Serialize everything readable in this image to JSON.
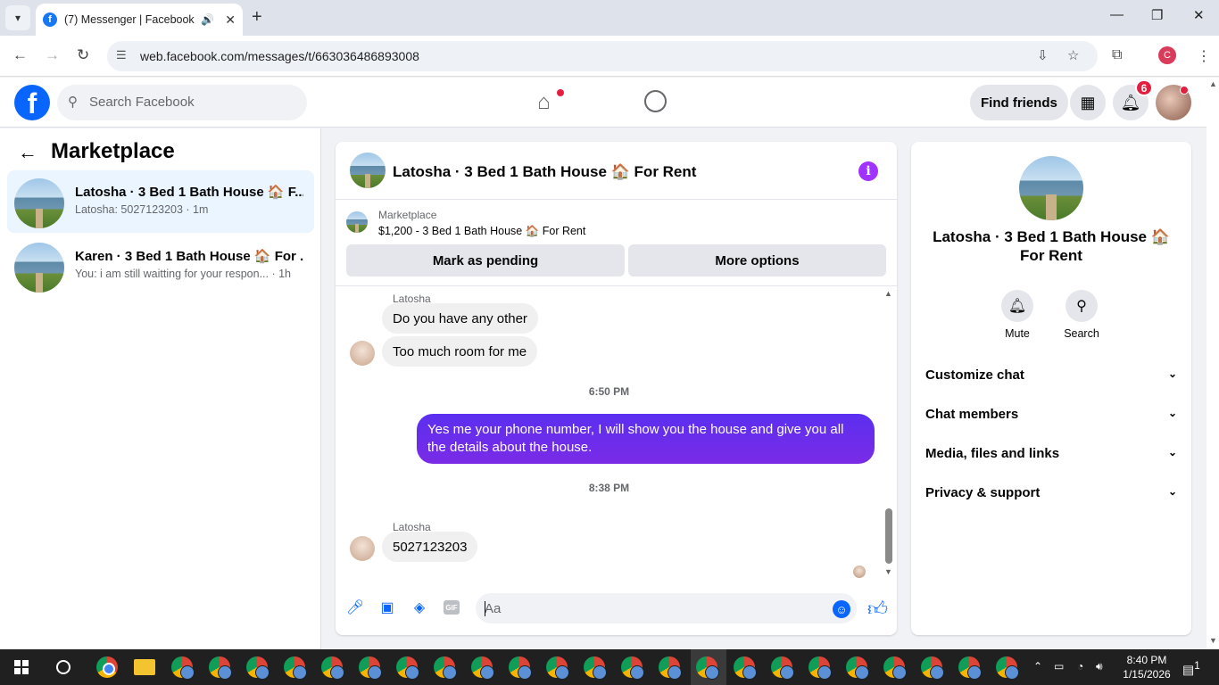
{
  "browser": {
    "tab_title": "(7) Messenger | Facebook",
    "url": "web.facebook.com/messages/t/663036486893008",
    "profile_initial": "C"
  },
  "fb": {
    "search_placeholder": "Search Facebook",
    "find_friends": "Find friends",
    "notification_count": "6"
  },
  "left": {
    "title": "Marketplace",
    "conversations": [
      {
        "name": "Latosha · 3 Bed 1 Bath House 🏠 F...",
        "preview": "Latosha: 5027123203 · 1m"
      },
      {
        "name": "Karen · 3 Bed 1 Bath House 🏠 For ...",
        "preview": "You: i am still waitting for your respon... · 1h"
      }
    ]
  },
  "chat": {
    "title": "Latosha · 3 Bed 1 Bath House 🏠 For Rent",
    "marketplace_label": "Marketplace",
    "listing": "$1,200 - 3 Bed 1 Bath House 🏠 For Rent",
    "mark_pending": "Mark as pending",
    "more_options": "More options",
    "messages": {
      "sender_1": "Latosha",
      "in_1": "Do you have any other",
      "in_2": "Too much room for me",
      "time_1": "6:50 PM",
      "out_1": "Yes me your phone number, I will show you the house and give you all the details about the house.",
      "time_2": "8:38 PM",
      "sender_2": "Latosha",
      "in_3": "5027123203"
    },
    "composer_placeholder": "Aa",
    "gif_label": "GIF"
  },
  "info": {
    "name": "Latosha · 3 Bed 1 Bath House 🏠 For Rent",
    "mute": "Mute",
    "search": "Search",
    "sections": [
      "Customize chat",
      "Chat members",
      "Media, files and links",
      "Privacy & support"
    ]
  },
  "taskbar": {
    "time": "8:40 PM",
    "date": "1/15/2026",
    "notif_count": "1"
  },
  "colors": {
    "fb_blue": "#0866ff",
    "outgoing_bubble": "#6b2bea",
    "active_conversation": "#ebf5ff",
    "badge_red": "#e41e3f"
  }
}
